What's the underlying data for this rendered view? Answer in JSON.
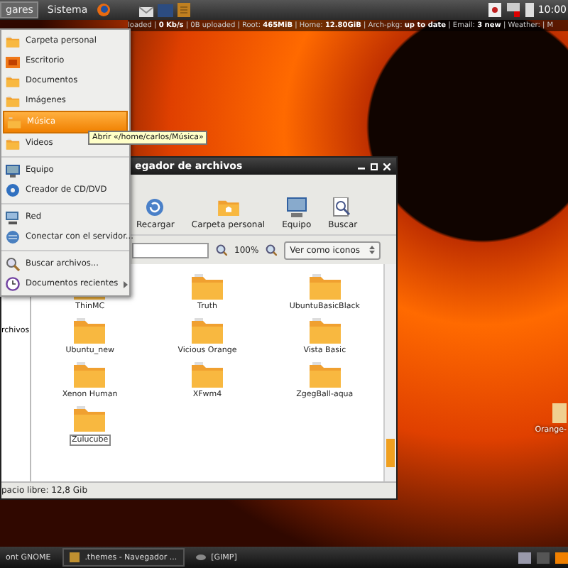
{
  "top_panel": {
    "menus": [
      {
        "label": "gares",
        "selected": true
      },
      {
        "label": "Sistema",
        "selected": false
      }
    ],
    "clock": "10:00"
  },
  "status_strip": "loaded | **0 Kb/s** | 0B uploaded | Root: **465MiB** | Home: **12.80GiB** | Arch-pkg: **up to date** | Email: **3 new** | Weather: | M",
  "places_menu": {
    "groups": [
      [
        {
          "label": "Carpeta personal",
          "kind": "folder",
          "selected": false
        },
        {
          "label": "Escritorio",
          "kind": "desktop",
          "selected": false
        },
        {
          "label": "Documentos",
          "kind": "folder",
          "selected": false
        },
        {
          "label": "Imágenes",
          "kind": "folder",
          "selected": false
        },
        {
          "label": "Música",
          "kind": "folder",
          "selected": true
        },
        {
          "label": "Videos",
          "kind": "folder",
          "selected": false
        }
      ],
      [
        {
          "label": "Equipo",
          "kind": "computer",
          "selected": false
        },
        {
          "label": "Creador de CD/DVD",
          "kind": "disc",
          "selected": false
        }
      ],
      [
        {
          "label": "Red",
          "kind": "network",
          "selected": false
        },
        {
          "label": "Conectar con el servidor...",
          "kind": "connect",
          "selected": false
        }
      ],
      [
        {
          "label": "Buscar archivos...",
          "kind": "search",
          "selected": false
        },
        {
          "label": "Documentos recientes",
          "kind": "recent",
          "selected": false,
          "submenu": true
        }
      ]
    ]
  },
  "tooltip": "Abrir «/home/carlos/Música»",
  "file_manager": {
    "title": "egador de archivos",
    "toolbar": [
      {
        "label": "Recargar",
        "kind": "reload"
      },
      {
        "label": "Carpeta personal",
        "kind": "home"
      },
      {
        "label": "Equipo",
        "kind": "computer"
      },
      {
        "label": "Buscar",
        "kind": "search"
      }
    ],
    "zoom": "100%",
    "view_mode": "Ver como iconos",
    "sidebar_text": "rchivos",
    "folders": [
      {
        "name": "ThinMC",
        "selected": false
      },
      {
        "name": "Truth",
        "selected": false
      },
      {
        "name": "UbuntuBasicBlack",
        "selected": false
      },
      {
        "name": "Ubuntu_new",
        "selected": false
      },
      {
        "name": "Vicious Orange",
        "selected": false
      },
      {
        "name": "Vista Basic",
        "selected": false
      },
      {
        "name": "Xenon Human",
        "selected": false
      },
      {
        "name": "XFwm4",
        "selected": false
      },
      {
        "name": "ZgegBall-aqua",
        "selected": false
      },
      {
        "name": "Zulucube",
        "selected": true
      }
    ],
    "status": "pacio libre: 12,8 Gib"
  },
  "desktop_icons": [
    {
      "label": "Orange-"
    }
  ],
  "taskbar": {
    "tasks": [
      {
        "label": "ont GNOME",
        "kind": "plain",
        "selected": false
      },
      {
        "label": ".themes - Navegador ...",
        "kind": "folder",
        "selected": true
      },
      {
        "label": "[GIMP]",
        "kind": "app",
        "selected": false
      }
    ]
  }
}
